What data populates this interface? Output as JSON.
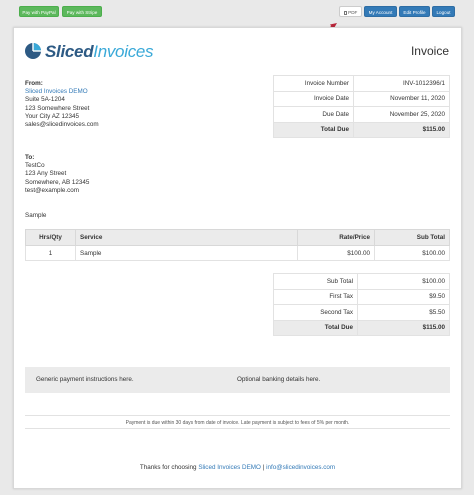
{
  "toolbar": {
    "paypal_label": "Pay with PayPal",
    "stripe_label": "Pay with Stripe",
    "pdf_label": "PDF",
    "account_label": "My Account",
    "edit_profile_label": "Edit Profile",
    "logout_label": "Logout"
  },
  "brand": {
    "name_bold": "Sliced",
    "name_light": "Invoices"
  },
  "invoice": {
    "title": "Invoice",
    "meta": [
      {
        "label": "Invoice Number",
        "value": "INV-1012396/1"
      },
      {
        "label": "Invoice Date",
        "value": "November 11, 2020"
      },
      {
        "label": "Due Date",
        "value": "November 25, 2020"
      }
    ],
    "total_due_label": "Total Due",
    "total_due_value": "$115.00"
  },
  "from": {
    "heading": "From:",
    "name": "Sliced Invoices DEMO",
    "line1": "Suite 5A-1204",
    "line2": "123 Somewhere Street",
    "line3": "Your City AZ 12345",
    "email": "sales@slicedinvoices.com"
  },
  "to": {
    "heading": "To:",
    "name": "TestCo",
    "line1": "123 Any Street",
    "line2": "Somewhere, AB 12345",
    "email": "test@example.com"
  },
  "description": "Sample",
  "items_table": {
    "headers": {
      "qty": "Hrs/Qty",
      "service": "Service",
      "rate": "Rate/Price",
      "subtotal": "Sub Total"
    },
    "rows": [
      {
        "qty": "1",
        "service": "Sample",
        "rate": "$100.00",
        "subtotal": "$100.00"
      }
    ]
  },
  "totals": {
    "rows": [
      {
        "label": "Sub Total",
        "value": "$100.00"
      },
      {
        "label": "First Tax",
        "value": "$9.50"
      },
      {
        "label": "Second Tax",
        "value": "$5.50"
      }
    ],
    "total_label": "Total Due",
    "total_value": "$115.00"
  },
  "payment": {
    "generic": "Generic payment instructions here.",
    "banking": "Optional banking details here."
  },
  "terms": "Payment is due within 30 days from date of invoice. Late payment is subject to fees of 5% per month.",
  "footer": {
    "prefix": "Thanks for choosing ",
    "company": "Sliced Invoices DEMO",
    "separator": " | ",
    "email": "info@slicedinvoices.com"
  },
  "colors": {
    "accent_blue": "#337ab7",
    "brand_dark": "#2d5a84",
    "brand_light": "#3aa9d8",
    "pay_green": "#5cb85c",
    "arrow_red": "#b8263a"
  }
}
